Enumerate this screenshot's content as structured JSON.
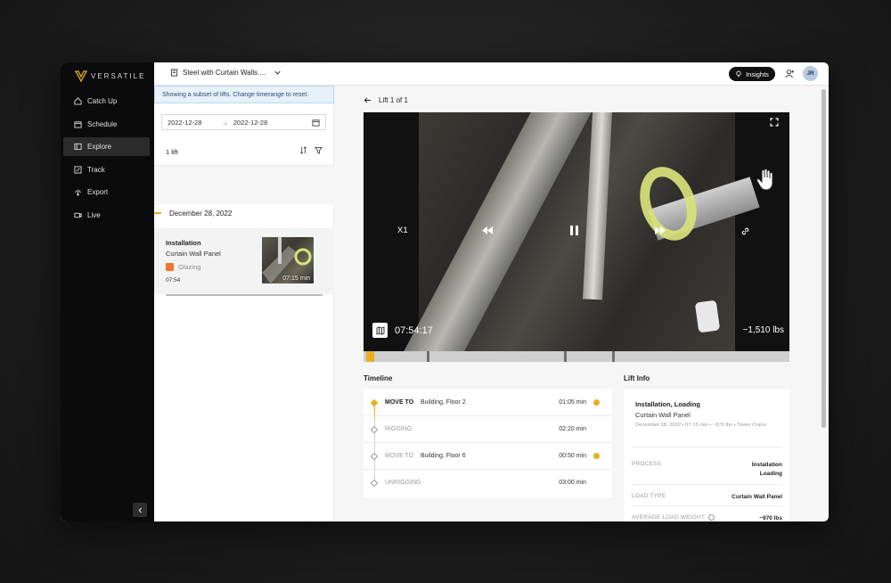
{
  "app": {
    "logo_text": "VERSATILE",
    "brand_accent": "#e8b021"
  },
  "sidebar": {
    "items": [
      {
        "label": "Catch Up",
        "icon": "home-icon"
      },
      {
        "label": "Schedule",
        "icon": "calendar-icon"
      },
      {
        "label": "Explore",
        "icon": "explore-icon",
        "active": true
      },
      {
        "label": "Track",
        "icon": "track-icon"
      },
      {
        "label": "Export",
        "icon": "export-icon"
      },
      {
        "label": "Live",
        "icon": "camera-icon"
      }
    ],
    "collapse_icon": "chevron-left-icon"
  },
  "topbar": {
    "project": "Steel with Curtain Walls ...",
    "insights_label": "Insights",
    "avatar_initials": "JR"
  },
  "list": {
    "banner": "Showing a subset of lifts. Change timerange to reset.",
    "date_from": "2022-12-28",
    "date_to": "2022-12-28",
    "lift_count": "1 lift",
    "group_date": "December 28, 2022",
    "card": {
      "title": "Installation",
      "subtitle": "Curtain Wall Panel",
      "tag": "Glazing",
      "tag_color": "#f07431",
      "time": "07:54",
      "thumb_label": "07:15 min"
    }
  },
  "main": {
    "lift_title": "Lift 1 of 1",
    "video": {
      "speed": "X1",
      "timestamp": "07:54:17",
      "weight": "~1,510 lbs"
    },
    "timeline_title": "Timeline",
    "timeline": [
      {
        "action": "MOVE TO",
        "location": "Building, Floor 2",
        "duration": "01:05 min",
        "active": true,
        "dot": true
      },
      {
        "action": "RIGGING",
        "location": "",
        "duration": "02:20 min",
        "active": false,
        "dot": false
      },
      {
        "action": "MOVE TO",
        "location": "Building, Floor 6",
        "duration": "00:50 min",
        "active": false,
        "dot": true
      },
      {
        "action": "UNRIGGING",
        "location": "",
        "duration": "03:00 min",
        "active": false,
        "dot": false
      }
    ],
    "lift_info_title": "Lift Info",
    "lift_info": {
      "title": "Installation, Loading",
      "subtitle": "Curtain Wall Panel",
      "meta": "December 28, 2022 • 07:15 min • ~970 lbs • Tower Crane",
      "process_label": "PROCESS",
      "process_value_1": "Installation",
      "process_value_2": "Loading",
      "load_type_label": "LOAD TYPE",
      "load_type_value": "Curtain Wall Panel",
      "avg_weight_label": "AVERAGE LOAD WEIGHT",
      "avg_weight_value": "~970 lbs"
    }
  }
}
